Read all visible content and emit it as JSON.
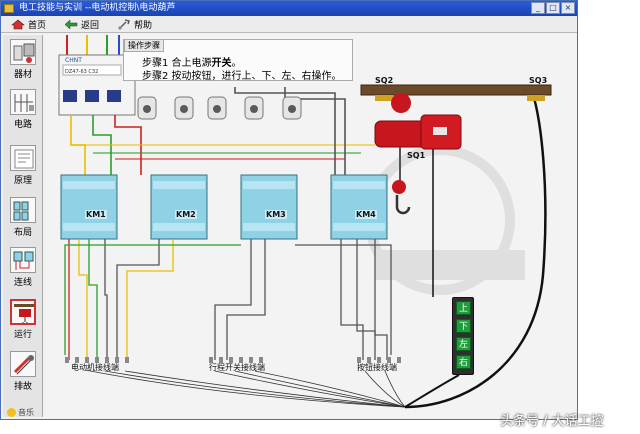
{
  "window": {
    "title": "电工技能与实训 --电动机控制\\电动葫芦",
    "controls": [
      "_",
      "□",
      "×"
    ]
  },
  "toolbar": {
    "home_label": "首页",
    "back_label": "返回",
    "help_label": "帮助"
  },
  "sidebar": {
    "items": [
      {
        "label": "器材",
        "icon": "equipment-icon"
      },
      {
        "label": "电路",
        "icon": "circuit-icon"
      },
      {
        "label": "原理",
        "icon": "principle-icon"
      },
      {
        "label": "布局",
        "icon": "layout-icon"
      },
      {
        "label": "连线",
        "icon": "wiring-icon"
      },
      {
        "label": "运行",
        "icon": "run-icon",
        "active": true
      },
      {
        "label": "排故",
        "icon": "troubleshoot-icon"
      }
    ],
    "music_label": "音乐"
  },
  "steps": {
    "tab_label": "操作步骤",
    "step1_prefix": "步骤1  合上电源",
    "step1_bold": "开关",
    "step1_suffix": "。",
    "step2": "步骤2  按动按钮，进行上、下、左、右操作。"
  },
  "breaker": {
    "brand": "CHNT",
    "model": "DZ47-63 C32"
  },
  "contactors": [
    "KM1",
    "KM2",
    "KM3",
    "KM4"
  ],
  "limit_switches": [
    "SQ2",
    "SQ3",
    "SQ1"
  ],
  "terminals": {
    "motor": "电动机接线端",
    "limit": "行程开关接线端",
    "button": "按钮接线端"
  },
  "pendant": {
    "buttons": [
      "上",
      "下",
      "左",
      "右"
    ],
    "color": "#1e9e3a"
  },
  "colors": {
    "phase_l1": "#e8c000",
    "phase_l2": "#2aa02a",
    "phase_l3": "#d02020",
    "contactor_body": "#8fd2e6",
    "hoist_red": "#c8161e",
    "beam": "#6b4a2a",
    "titlebar": "#2a5bd7"
  },
  "watermark": "头条号 / 大话工控"
}
